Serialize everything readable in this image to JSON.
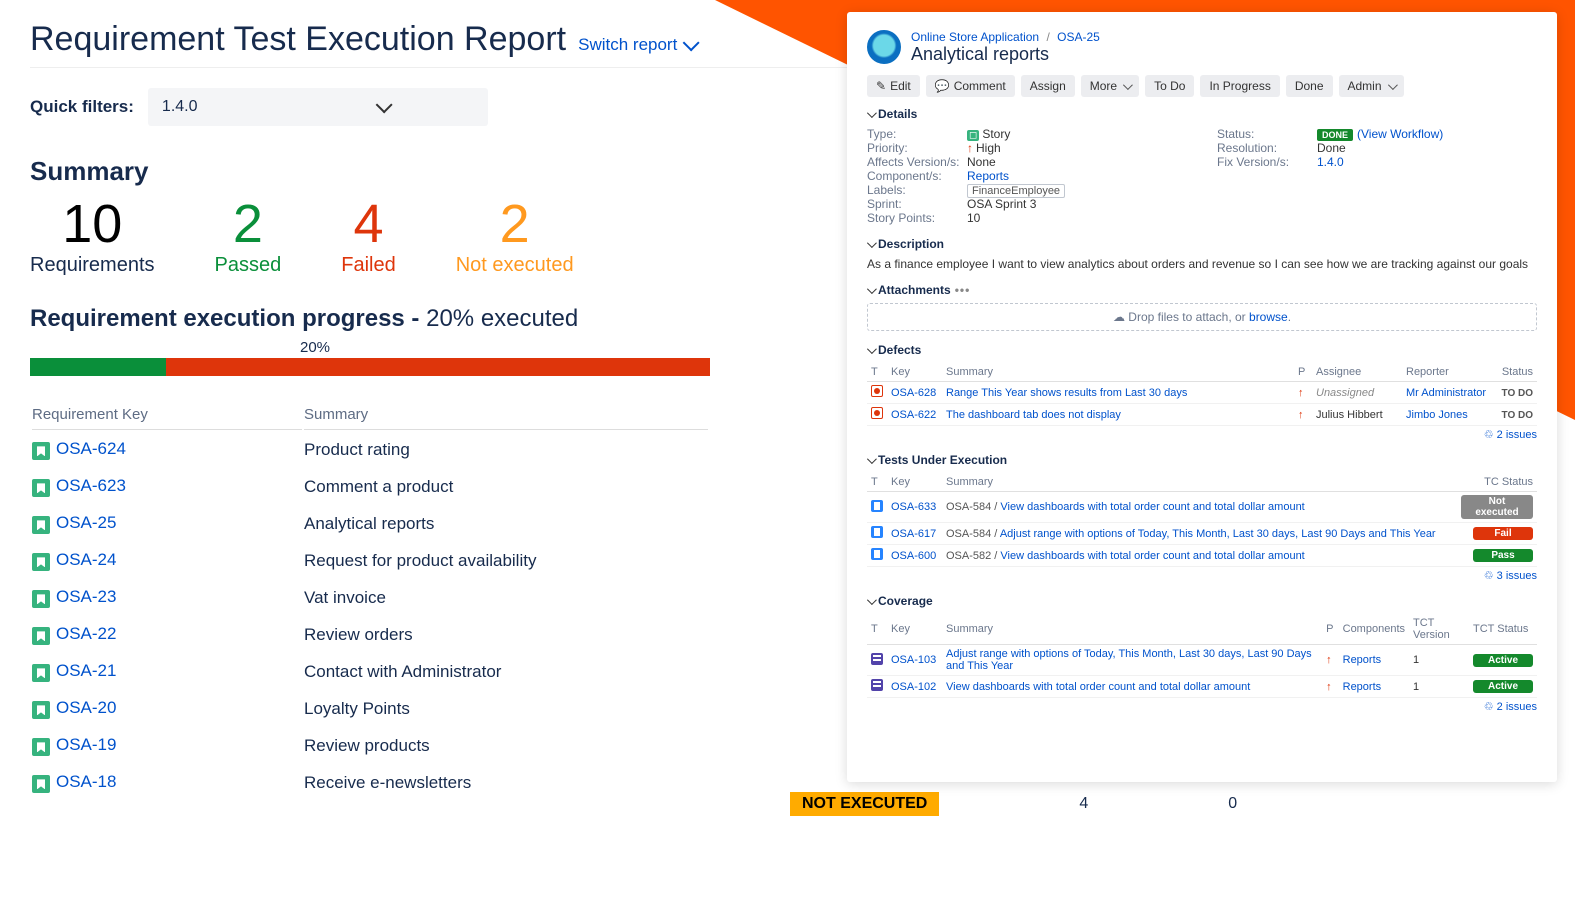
{
  "report": {
    "title": "Requirement Test Execution Report",
    "switch": "Switch report",
    "filters_label": "Quick filters:",
    "filter_value": "1.4.0",
    "summary_heading": "Summary",
    "cards": {
      "requirements": {
        "value": "10",
        "label": "Requirements"
      },
      "passed": {
        "value": "2",
        "label": "Passed"
      },
      "failed": {
        "value": "4",
        "label": "Failed"
      },
      "notexec": {
        "value": "2",
        "label": "Not executed"
      }
    },
    "progress_heading": "Requirement execution progress -",
    "progress_pct_text": "20% executed",
    "progress_pct_small": "20%",
    "progress_pct": 20,
    "table": {
      "col_key": "Requirement Key",
      "col_summary": "Summary",
      "rows": [
        {
          "key": "OSA-624",
          "summary": "Product rating"
        },
        {
          "key": "OSA-623",
          "summary": "Comment a product"
        },
        {
          "key": "OSA-25",
          "summary": "Analytical reports"
        },
        {
          "key": "OSA-24",
          "summary": "Request for product availability"
        },
        {
          "key": "OSA-23",
          "summary": "Vat invoice"
        },
        {
          "key": "OSA-22",
          "summary": "Review orders"
        },
        {
          "key": "OSA-21",
          "summary": "Contact with Administrator"
        },
        {
          "key": "OSA-20",
          "summary": "Loyalty Points"
        },
        {
          "key": "OSA-19",
          "summary": "Review products"
        },
        {
          "key": "OSA-18",
          "summary": "Receive e-newsletters"
        }
      ]
    }
  },
  "panel": {
    "breadcrumb_app": "Online Store Application",
    "breadcrumb_key": "OSA-25",
    "title": "Analytical reports",
    "toolbar": {
      "edit": "Edit",
      "comment": "Comment",
      "assign": "Assign",
      "more": "More",
      "todo": "To Do",
      "inprogress": "In Progress",
      "done": "Done",
      "admin": "Admin"
    },
    "details": {
      "h": "Details",
      "type_k": "Type:",
      "type_v": "Story",
      "priority_k": "Priority:",
      "priority_v": "High",
      "affects_k": "Affects Version/s:",
      "affects_v": "None",
      "components_k": "Component/s:",
      "components_v": "Reports",
      "labels_k": "Labels:",
      "labels_v": "FinanceEmployee",
      "sprint_k": "Sprint:",
      "sprint_v": "OSA Sprint 3",
      "points_k": "Story Points:",
      "points_v": "10",
      "status_k": "Status:",
      "status_v": "DONE",
      "status_link": "(View Workflow)",
      "resolution_k": "Resolution:",
      "resolution_v": "Done",
      "fixv_k": "Fix Version/s:",
      "fixv_v": "1.4.0"
    },
    "description": {
      "h": "Description",
      "text": "As a finance employee I want to view analytics about orders and revenue so I can see how we are tracking against our goals"
    },
    "attachments": {
      "h": "Attachments",
      "drop": "Drop files to attach, or ",
      "browse": "browse"
    },
    "defects": {
      "h": "Defects",
      "cols": {
        "t": "T",
        "key": "Key",
        "summary": "Summary",
        "p": "P",
        "assignee": "Assignee",
        "reporter": "Reporter",
        "status": "Status"
      },
      "rows": [
        {
          "key": "OSA-628",
          "summary": "Range This Year shows results from Last 30 days",
          "assignee": "Unassigned",
          "assignee_italic": true,
          "reporter": "Mr Administrator",
          "status": "TO DO"
        },
        {
          "key": "OSA-622",
          "summary": "The dashboard tab does not display",
          "assignee": "Julius Hibbert",
          "reporter": "Jimbo Jones",
          "status": "TO DO"
        }
      ],
      "count": "2 issues"
    },
    "tests": {
      "h": "Tests Under Execution",
      "cols": {
        "t": "T",
        "key": "Key",
        "summary": "Summary",
        "status": "TC Status"
      },
      "rows": [
        {
          "key": "OSA-633",
          "prefix": "OSA-584 /",
          "summary": "View dashboards with total order count and total dollar amount",
          "status": "Not executed",
          "pill": "grey"
        },
        {
          "key": "OSA-617",
          "prefix": "OSA-584 /",
          "summary": "Adjust range with options of Today, This Month, Last 30 days, Last 90 Days and This Year",
          "status": "Fail",
          "pill": "red"
        },
        {
          "key": "OSA-600",
          "prefix": "OSA-582 /",
          "summary": "View dashboards with total order count and total dollar amount",
          "status": "Pass",
          "pill": "green"
        }
      ],
      "count": "3 issues"
    },
    "coverage": {
      "h": "Coverage",
      "cols": {
        "t": "T",
        "key": "Key",
        "summary": "Summary",
        "p": "P",
        "components": "Components",
        "tctv": "TCT Version",
        "tcts": "TCT Status"
      },
      "rows": [
        {
          "key": "OSA-103",
          "summary": "Adjust range with options of Today, This Month, Last 30 days, Last 90 Days and This Year",
          "components": "Reports",
          "tctv": "1",
          "tcts": "Active"
        },
        {
          "key": "OSA-102",
          "summary": "View dashboards with total order count and total dollar amount",
          "components": "Reports",
          "tctv": "1",
          "tcts": "Active"
        }
      ],
      "count": "2 issues"
    }
  },
  "bottom": {
    "label": "NOT EXECUTED",
    "v1": "4",
    "v2": "0"
  }
}
